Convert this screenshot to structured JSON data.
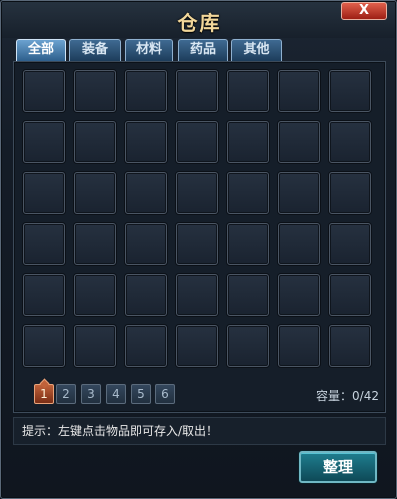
{
  "window": {
    "title": "仓库",
    "close_label": "X"
  },
  "tabs": [
    {
      "label": "全部",
      "active": true
    },
    {
      "label": "装备",
      "active": false
    },
    {
      "label": "材料",
      "active": false
    },
    {
      "label": "药品",
      "active": false
    },
    {
      "label": "其他",
      "active": false
    }
  ],
  "grid": {
    "rows": 6,
    "cols": 7
  },
  "pagination": {
    "pages": [
      "1",
      "2",
      "3",
      "4",
      "5",
      "6"
    ],
    "current": "1"
  },
  "capacity": {
    "text": "容量：0/42"
  },
  "hint": {
    "text": "提示：左键点击物品即可存入/取出！"
  },
  "sort_button": {
    "label": "整理"
  },
  "colors": {
    "title": "#f2d79a",
    "tab_active": "#6ba2d0",
    "page_active": "#c0623a",
    "button": "#1f7e8f"
  }
}
